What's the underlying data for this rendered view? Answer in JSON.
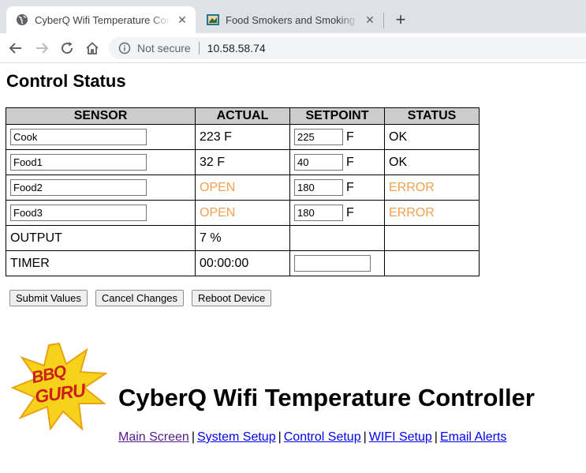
{
  "browser": {
    "tabs": [
      {
        "title": "CyberQ Wifi Temperature Controller",
        "active": true
      },
      {
        "title": "Food Smokers and Smoking Tips",
        "active": false
      }
    ],
    "new_tab": "+",
    "security_label": "Not secure",
    "url": "10.58.58.74"
  },
  "page": {
    "title": "Control Status",
    "table": {
      "headers": [
        "SENSOR",
        "ACTUAL",
        "SETPOINT",
        "STATUS"
      ],
      "sensors": [
        {
          "name": "Cook",
          "actual": "223 F",
          "setpoint": "225",
          "unit": "F",
          "status": "OK"
        },
        {
          "name": "Food1",
          "actual": "32 F",
          "setpoint": "40",
          "unit": "F",
          "status": "OK"
        },
        {
          "name": "Food2",
          "actual": "OPEN",
          "setpoint": "180",
          "unit": "F",
          "status": "ERROR"
        },
        {
          "name": "Food3",
          "actual": "OPEN",
          "setpoint": "180",
          "unit": "F",
          "status": "ERROR"
        }
      ],
      "output": {
        "label": "OUTPUT",
        "value": "7 %"
      },
      "timer": {
        "label": "TIMER",
        "value": "00:00:00",
        "setpoint": ""
      }
    },
    "buttons": {
      "submit": "Submit Values",
      "cancel": "Cancel Changes",
      "reboot": "Reboot Device"
    },
    "logo": {
      "line1": "BBQ",
      "line2": "GURU"
    },
    "app_title": "CyberQ Wifi Temperature Controller",
    "links": [
      "Main Screen",
      "System Setup",
      "Control Setup",
      "WIFI Setup",
      "Email Alerts"
    ],
    "link_separator": "|"
  },
  "colors": {
    "warning": "#f0a050",
    "header_bg": "#cccccc",
    "link": "#0000ee",
    "visited_link": "#551a8b"
  }
}
